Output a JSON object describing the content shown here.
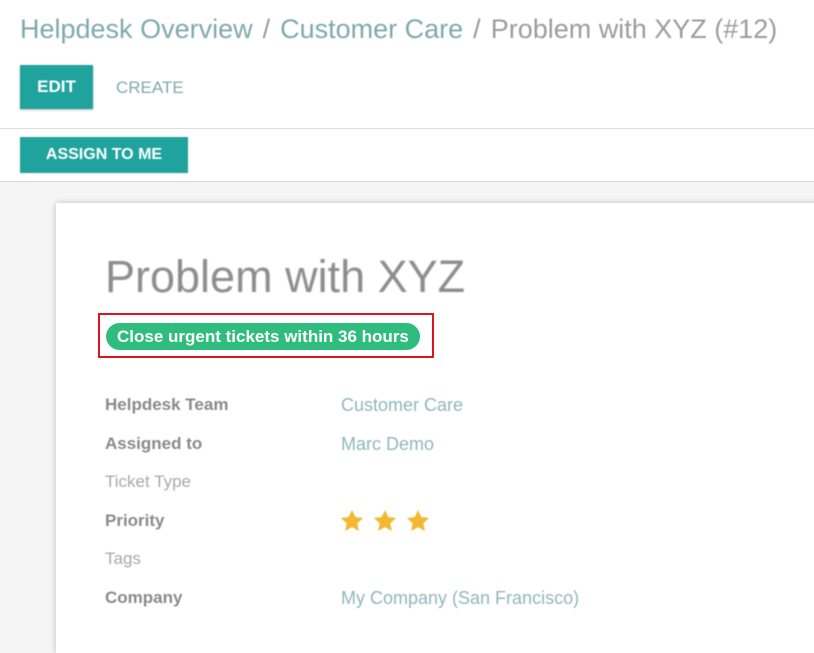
{
  "breadcrumb": {
    "items": [
      "Helpdesk Overview",
      "Customer Care"
    ],
    "current": "Problem with XYZ (#12)",
    "separator": "/"
  },
  "toolbar": {
    "edit_label": "EDIT",
    "create_label": "CREATE"
  },
  "statusbar": {
    "assign_label": "ASSIGN TO ME"
  },
  "ticket": {
    "title": "Problem with XYZ",
    "sla_badge": "Close urgent tickets within 36 hours",
    "fields": {
      "team": {
        "label": "Helpdesk Team",
        "value": "Customer Care"
      },
      "assigned": {
        "label": "Assigned to",
        "value": "Marc Demo"
      },
      "type": {
        "label": "Ticket Type",
        "value": ""
      },
      "priority": {
        "label": "Priority",
        "stars": 3
      },
      "tags": {
        "label": "Tags",
        "value": ""
      },
      "company": {
        "label": "Company",
        "value": "My Company (San Francisco)"
      }
    }
  },
  "colors": {
    "accent": "#1fa39c",
    "link": "#7fa9ac",
    "sla_green": "#2fbd7e",
    "highlight_red": "#e0141e",
    "star": "#f3b830"
  }
}
